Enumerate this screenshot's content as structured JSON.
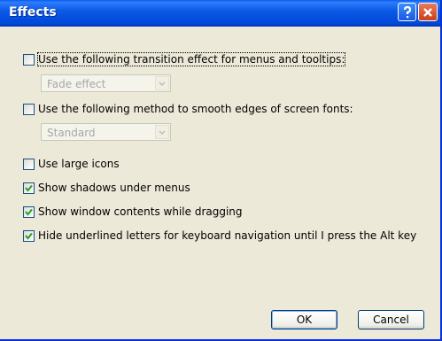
{
  "window": {
    "title": "Effects"
  },
  "titlebar": {
    "help_icon": "question-mark-icon",
    "close_icon": "close-x-icon"
  },
  "options": [
    {
      "label": "Use the following transition effect for menus and tooltips:",
      "checked": false
    },
    {
      "label": "Use the following method to smooth edges of screen fonts:",
      "checked": false
    },
    {
      "label": "Use large icons",
      "checked": false
    },
    {
      "label": "Show shadows under menus",
      "checked": true
    },
    {
      "label": "Show window contents while dragging",
      "checked": true
    },
    {
      "label": "Hide underlined letters for keyboard navigation until I press the Alt key",
      "checked": true
    }
  ],
  "transition_combo": {
    "value": "Fade effect",
    "enabled": false
  },
  "smoothing_combo": {
    "value": "Standard",
    "enabled": false
  },
  "buttons": {
    "ok": "OK",
    "cancel": "Cancel"
  },
  "colors": {
    "titlebar": "#0b5ae6",
    "face": "#ece9d8",
    "check": "#21a121"
  }
}
